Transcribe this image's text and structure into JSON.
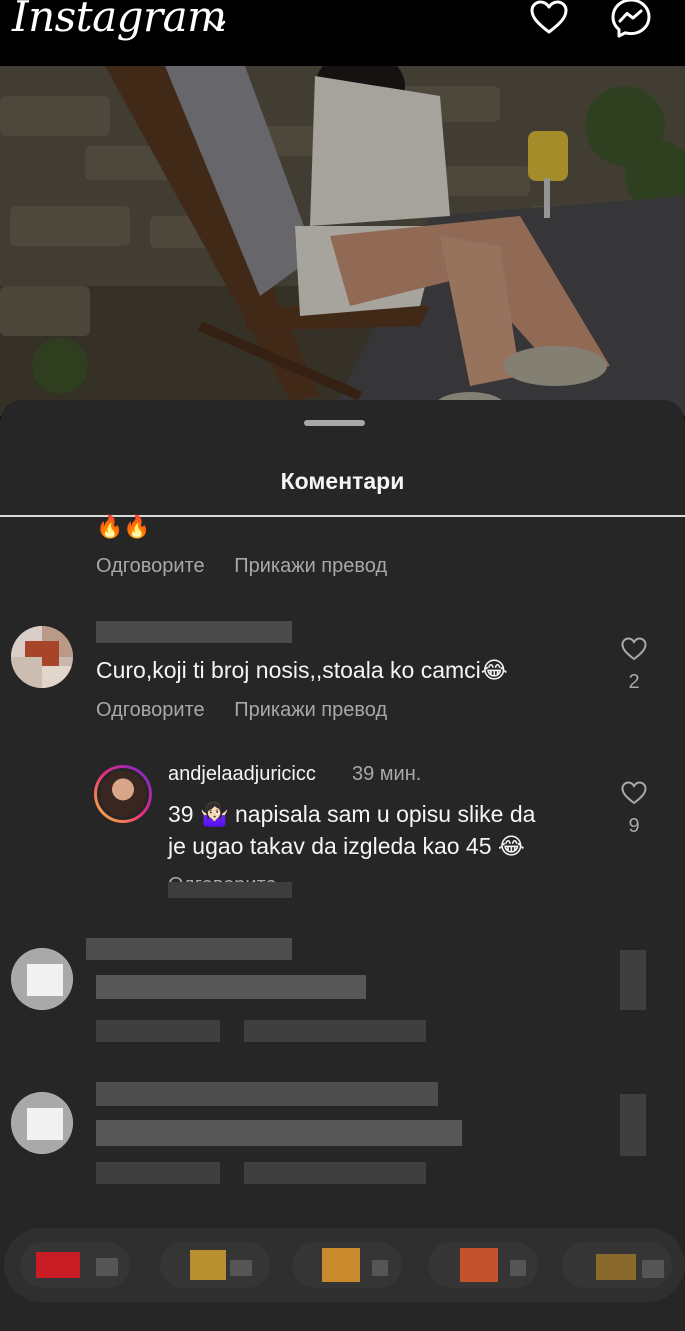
{
  "header": {
    "logo_text": "Instagram"
  },
  "sheet": {
    "title": "Коментари"
  },
  "comments": [
    {
      "emoji_line": "🔥🔥",
      "reply_label": "Одговорите",
      "translate_label": "Прикажи превод"
    },
    {
      "text": "Curo,koji ti broj nosis,,stoala ko camci😂",
      "likes": "2",
      "reply_label": "Одговорите",
      "translate_label": "Прикажи превод"
    }
  ],
  "reply": {
    "username": "andjelaadjuricicc",
    "time": "39 мин.",
    "text_line1": "39 🤷🏻‍♀️ napisala sam u opisu slike da",
    "text_line2": "je ugao takav da izgleda kao 45 😂",
    "likes": "9",
    "reply_label": "Одговорите"
  },
  "colors": {
    "background": "#000000",
    "sheet": "#262626",
    "text_primary": "#f5f5f5",
    "text_secondary": "#a8a8a8"
  }
}
